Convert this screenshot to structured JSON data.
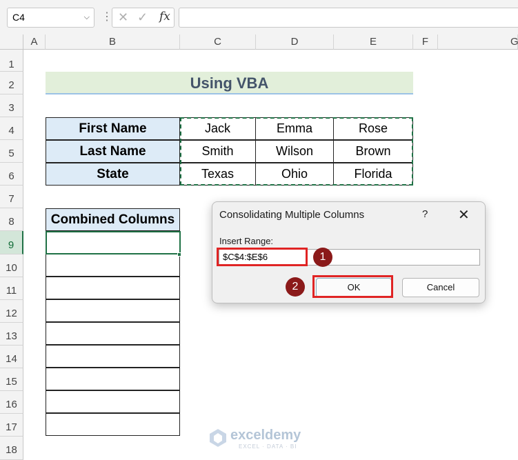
{
  "formula_bar": {
    "name_box": "C4",
    "cancel_glyph": "✕",
    "enter_glyph": "✓",
    "fx_label": "fx",
    "formula": ""
  },
  "columns": [
    "A",
    "B",
    "C",
    "D",
    "E",
    "F",
    "G"
  ],
  "rows": [
    "1",
    "2",
    "3",
    "4",
    "5",
    "6",
    "7",
    "8",
    "9",
    "10",
    "11",
    "12",
    "13",
    "14",
    "15",
    "16",
    "17",
    "18"
  ],
  "sheet": {
    "title": "Using VBA",
    "table": [
      {
        "header": "First Name",
        "values": [
          "Jack",
          "Emma",
          "Rose"
        ]
      },
      {
        "header": "Last Name",
        "values": [
          "Smith",
          "Wilson",
          "Brown"
        ]
      },
      {
        "header": "State",
        "values": [
          "Texas",
          "Ohio",
          "Florida"
        ]
      }
    ],
    "combined_header": "Combined Columns"
  },
  "dialog": {
    "title": "Consolidating Multiple Columns",
    "help": "?",
    "close": "✕",
    "label": "Insert Range:",
    "range_value": "$C$4:$E$6",
    "ok_label": "OK",
    "cancel_label": "Cancel",
    "step1": "1",
    "step2": "2"
  },
  "watermark": {
    "name": "exceldemy",
    "tagline": "EXCEL · DATA · BI"
  },
  "colors": {
    "accent_green": "#1f7145",
    "highlight_red": "#e02424",
    "step_badge": "#8b1a1a",
    "header_fill": "#ddebf7",
    "title_fill": "#e2efda"
  }
}
